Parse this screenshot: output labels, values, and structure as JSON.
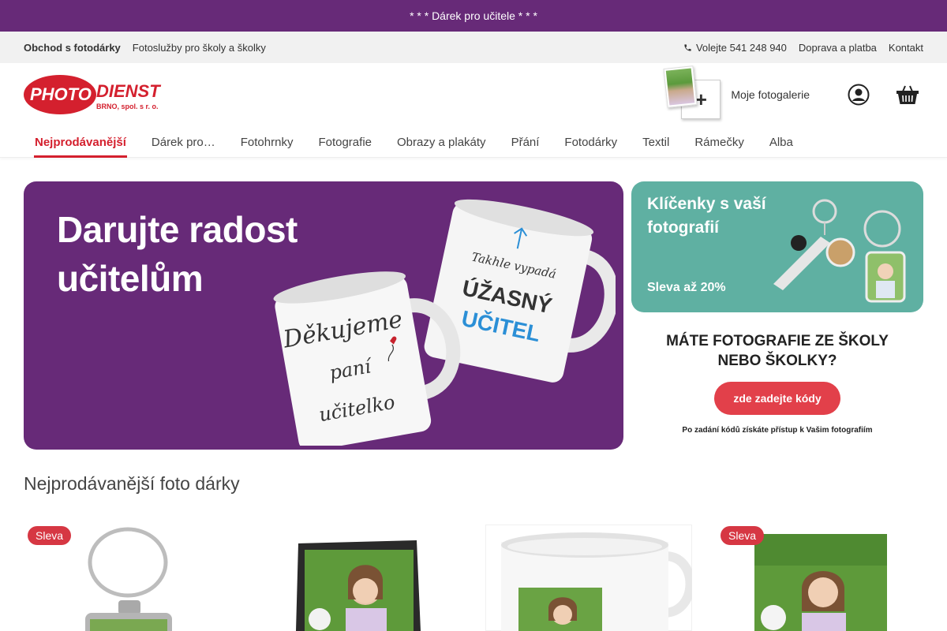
{
  "promo": {
    "text": "* * * Dárek pro učitele * * *"
  },
  "util": {
    "shop": "Obchod s fotodárky",
    "schools": "Fotoslužby pro školy a školky",
    "phone": "Volejte 541 248 940",
    "shipping": "Doprava a platba",
    "contact": "Kontakt"
  },
  "logo": {
    "main": "PHOTO DIENST",
    "sub": "BRNO, spol. s r. o."
  },
  "header": {
    "gallery_label": "Moje fotogalerie",
    "account_icon": "user-circle-icon",
    "cart_icon": "basket-icon"
  },
  "nav": {
    "items": [
      {
        "label": "Nejprodávanější",
        "active": true
      },
      {
        "label": "Dárek pro…"
      },
      {
        "label": "Fotohrnky"
      },
      {
        "label": "Fotografie"
      },
      {
        "label": "Obrazy a plakáty"
      },
      {
        "label": "Přání"
      },
      {
        "label": "Fotodárky"
      },
      {
        "label": "Textil"
      },
      {
        "label": "Rámečky"
      },
      {
        "label": "Alba"
      }
    ]
  },
  "hero": {
    "line1": "Darujte radost",
    "line2": "učitelům",
    "mug1_lines": [
      "Děkujeme",
      "paní",
      "učitelko"
    ],
    "mug2_small": "Takhle vypadá",
    "mug2_big": "ÚŽASNÝ",
    "mug2_blue": "UČITEL"
  },
  "side1": {
    "line1": "Klíčenky s vaší",
    "line2": "fotografií",
    "sale": "Sleva až 20%"
  },
  "side2": {
    "line1": "MÁTE FOTOGRAFIE ZE ŠKOLY",
    "line2": "NEBO ŠKOLKY?",
    "button": "zde zadejte kódy",
    "note": "Po zadání kódů získáte přístup k Vašim fotografiím"
  },
  "section": {
    "title": "Nejprodávanější foto dárky"
  },
  "products": [
    {
      "badge": "Sleva",
      "kind": "keychain"
    },
    {
      "badge": "",
      "kind": "slate"
    },
    {
      "badge": "",
      "kind": "mug"
    },
    {
      "badge": "Sleva",
      "kind": "photo"
    }
  ],
  "colors": {
    "brand_purple": "#672a78",
    "brand_red": "#d4202e",
    "teal": "#5fb0a2",
    "badge_red": "#d63743"
  }
}
